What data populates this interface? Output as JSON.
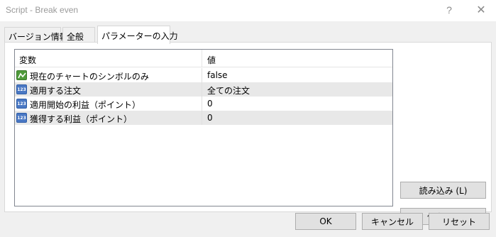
{
  "window": {
    "title": "Script - Break even",
    "help_label": "?",
    "close_label": "✕"
  },
  "tabs": [
    {
      "label": "バージョン情報"
    },
    {
      "label": "全般"
    },
    {
      "label": "パラメーターの入力"
    }
  ],
  "grid": {
    "columns": {
      "variable": "変数",
      "value": "値"
    },
    "rows": [
      {
        "name": "現在のチャートのシンボルのみ",
        "value": "false",
        "icon": "bool-icon"
      },
      {
        "name": "適用する注文",
        "value": "全ての注文",
        "icon": "number-icon"
      },
      {
        "name": "適用開始の利益（ポイント）",
        "value": "0",
        "icon": "number-icon"
      },
      {
        "name": "獲得する利益（ポイント）",
        "value": "0",
        "icon": "number-icon"
      }
    ],
    "number_icon_text": "123"
  },
  "buttons": {
    "load": "読み込み (L)",
    "save": "保存 (S)",
    "ok": "OK",
    "cancel": "キャンセル",
    "reset": "リセット"
  }
}
